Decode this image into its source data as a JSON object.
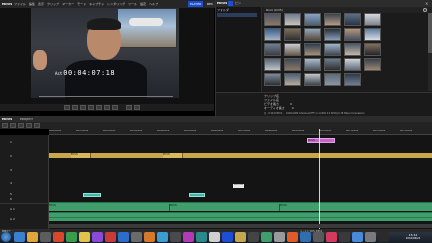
{
  "app": {
    "logo": "EDIUS",
    "menu": [
      "ファイル",
      "編集",
      "表示",
      "クリップ",
      "マーカー",
      "モード",
      "キャプチャ",
      "レンダリング",
      "ツール",
      "設定",
      "ヘルプ"
    ],
    "player_badge": "PLAYER",
    "rec_badge": "REC"
  },
  "player": {
    "timecode_prefix": "Ast",
    "timecode": "00:04:07:18"
  },
  "bin": {
    "logo": "EDIUS",
    "title": "ビン",
    "folder_label": "フォルダ",
    "path": "Root (0/35)"
  },
  "properties": {
    "rows": [
      {
        "label": "クリップ名",
        "value": ""
      },
      {
        "label": "ファイル名",
        "value": ""
      },
      {
        "label": "ビデオ長さ",
        "value": "0"
      },
      {
        "label": "オーディオ長さ",
        "value": "0"
      }
    ],
    "clip_info": "全 - H.264 EDIUS  ／ 1920x1080  Interlaced(TFF)  1:1.0000 0.0 SP4Q(1) 28 Mbps Compression"
  },
  "timeline": {
    "logo": "EDIUS",
    "sequence_name": "PROJECT",
    "ruler_labels": [
      "00:00:00;00",
      "00:01:00;00",
      "00:02:00;00",
      "00:03:00;00",
      "00:04:00;00",
      "00:05:00;00",
      "00:06:00;00",
      "00:07:00;00",
      "00:08:00;00",
      "00:09:00;00",
      "00:10:00;00",
      "00:11:00;00",
      "00:12:00;00",
      "00:13:00;00"
    ],
    "track_labels": [
      "1",
      "2",
      "3",
      "4",
      "5",
      "6",
      "A 1",
      "A 2"
    ],
    "clip_names": {
      "title": "EDIUS",
      "video_a": "EDIUS",
      "video_b": "EDIUS",
      "audio_1": "EDIUS",
      "audio_2": "EDIUS",
      "audio_3": "EDIUS",
      "marker": "00:07:00"
    }
  },
  "status": {
    "left": "準備完了",
    "right": "ディスク: 26% 使用中"
  },
  "taskbar": {
    "clock_time": "15:12",
    "clock_date": "2016/06/24"
  },
  "colors": {
    "panel_bg": "#1b1b1b",
    "title_bar": "#2c2c2c",
    "accent_blue": "#1d4fd6",
    "timeline_yellow": "#c8a64c",
    "audio_green": "#3f9e6c",
    "clip_cyan": "#3fb7a8",
    "marker_purple": "#c467c8",
    "playhead": "#ffffff"
  }
}
